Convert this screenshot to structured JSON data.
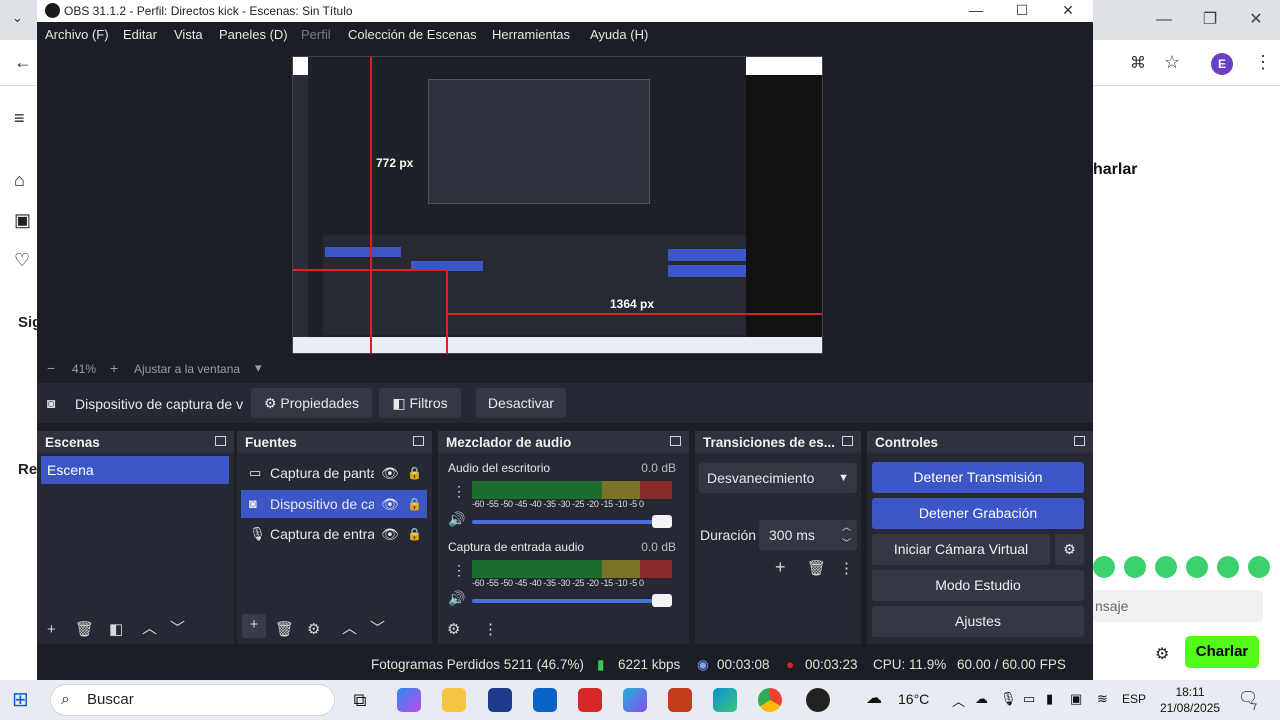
{
  "window": {
    "title": "OBS 31.1.2 - Perfil: Directos kick - Escenas: Sin Título",
    "minimize": "—",
    "maximize": "☐",
    "close": "✕"
  },
  "menu": [
    {
      "label": "Archivo (F)"
    },
    {
      "label": "Editar"
    },
    {
      "label": "Vista"
    },
    {
      "label": "Paneles (D)"
    },
    {
      "label": "Perfil"
    },
    {
      "label": "Colección de Escenas"
    },
    {
      "label": "Herramientas"
    },
    {
      "label": "Ayuda (H)"
    }
  ],
  "preview": {
    "measure_h": "772 px",
    "measure_w": "1364 px"
  },
  "zoom": {
    "minus": "−",
    "level": "41%",
    "plus": "+",
    "fit": "Ajustar a la ventana",
    "arrow": "▾"
  },
  "source_bar": {
    "selected_source": "Dispositivo de captura de v",
    "properties": "Propiedades",
    "filters": "Filtros",
    "deactivate": "Desactivar"
  },
  "docks": {
    "scenes": {
      "title": "Escenas",
      "items": [
        "Escena"
      ]
    },
    "sources": {
      "title": "Fuentes",
      "items": [
        {
          "label": "Captura de panta",
          "icon": "monitor-icon"
        },
        {
          "label": "Dispositivo de ca",
          "icon": "camera-icon"
        },
        {
          "label": "Captura de entra",
          "icon": "microphone-icon"
        }
      ]
    },
    "mixer": {
      "title": "Mezclador de audio",
      "meter_scale": "-60 -55 -50 -45 -40 -35 -30 -25 -20 -15 -10 -5  0",
      "channels": [
        {
          "name": "Audio del escritorio",
          "db": "0.0 dB"
        },
        {
          "name": "Captura de entrada audio",
          "db": "0.0 dB"
        }
      ]
    },
    "transitions": {
      "title": "Transiciones de es...",
      "type": "Desvanecimiento",
      "duration_label": "Duración",
      "duration_value": "300 ms"
    },
    "controls": {
      "title": "Controles",
      "stop_stream": "Detener Transmisión",
      "stop_record": "Detener Grabación",
      "virtual_cam": "Iniciar Cámara Virtual",
      "studio_mode": "Modo Estudio",
      "settings": "Ajustes"
    }
  },
  "status": {
    "dropped": "Fotogramas Perdidos 5211 (46.7%)",
    "bitrate": "6221 kbps",
    "stream_time": "00:03:08",
    "rec_time": "00:03:23",
    "cpu": "CPU: 11.9%",
    "fps": "60.00 / 60.00 FPS"
  },
  "background": {
    "chat_title": "harlar",
    "chat_placeholder": "nsaje",
    "send_button": "Charlar",
    "avatar_letter": "E",
    "left_labels": [
      "Sig",
      "Rec"
    ]
  },
  "taskbar": {
    "search": "Buscar",
    "weather": "16°C",
    "lang": "ESP",
    "time": "18:11",
    "date": "21/08/2025",
    "notif": "7"
  },
  "colors": {
    "obs_bg": "#1c1e26",
    "dock_bg": "#262933",
    "accent": "#3c56c5",
    "kick_green": "#53fc18"
  }
}
